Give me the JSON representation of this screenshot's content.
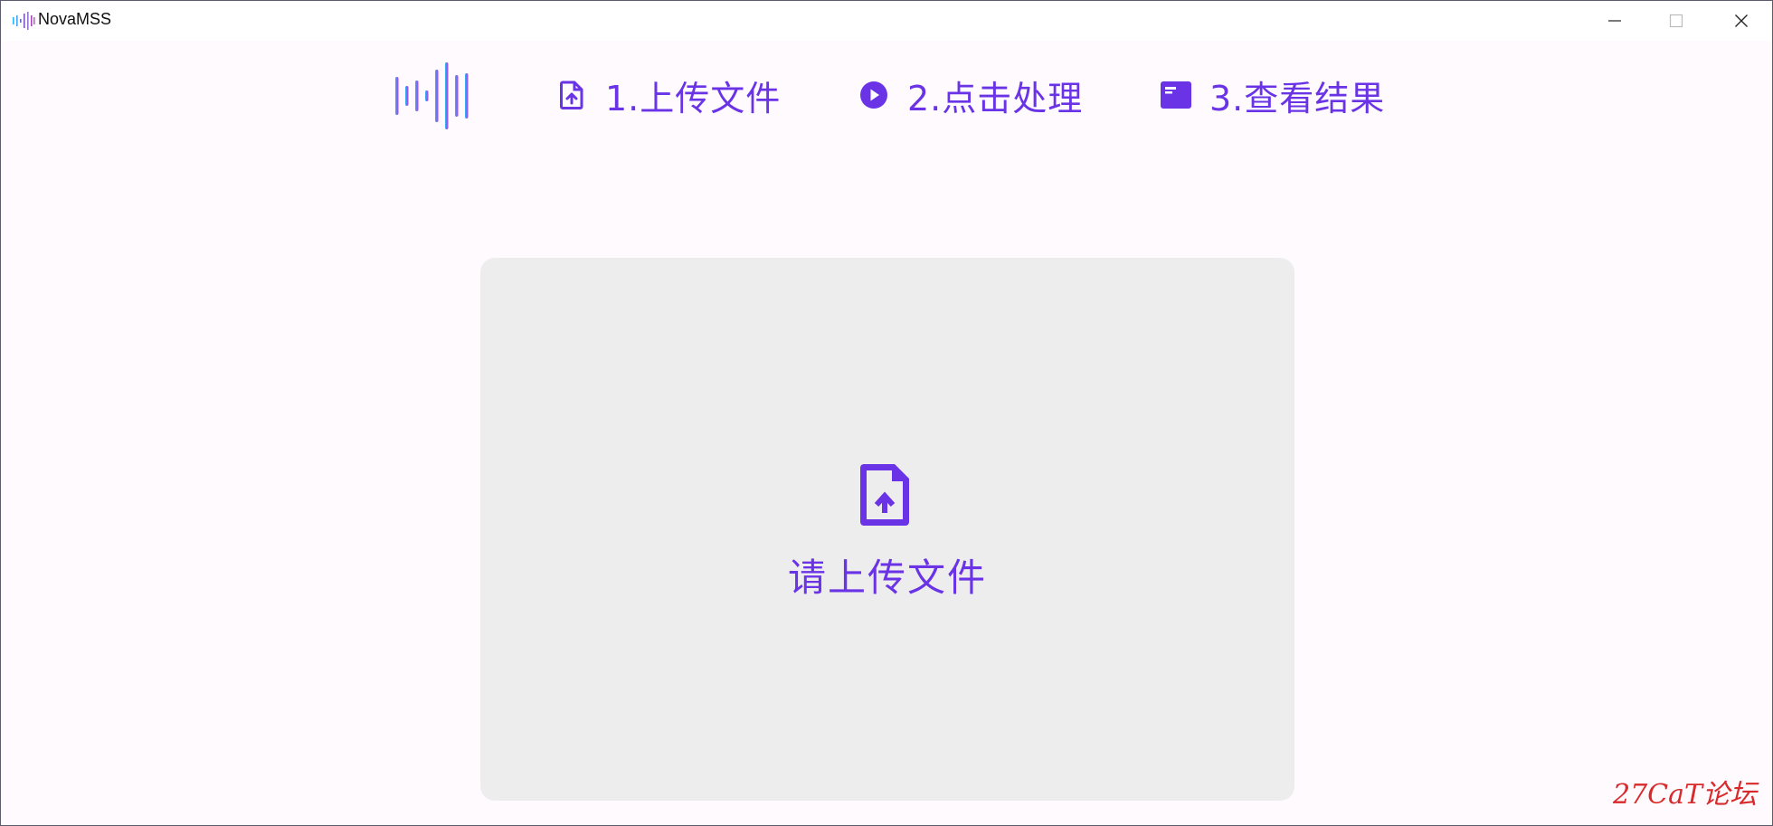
{
  "window": {
    "title": "NovaMSS"
  },
  "nav": {
    "steps": [
      {
        "label": "1.上传文件",
        "icon": "file-upload-icon"
      },
      {
        "label": "2.点击处理",
        "icon": "play-circle-icon"
      },
      {
        "label": "3.查看结果",
        "icon": "window-icon"
      }
    ]
  },
  "dropzone": {
    "label": "请上传文件",
    "icon": "file-upload-icon"
  },
  "watermark": {
    "text": "27CaT论坛"
  },
  "colors": {
    "accent": "#6a34e6",
    "dropzone_bg": "#ededed",
    "page_bg": "#fefafe",
    "watermark": "#d82a2a"
  }
}
